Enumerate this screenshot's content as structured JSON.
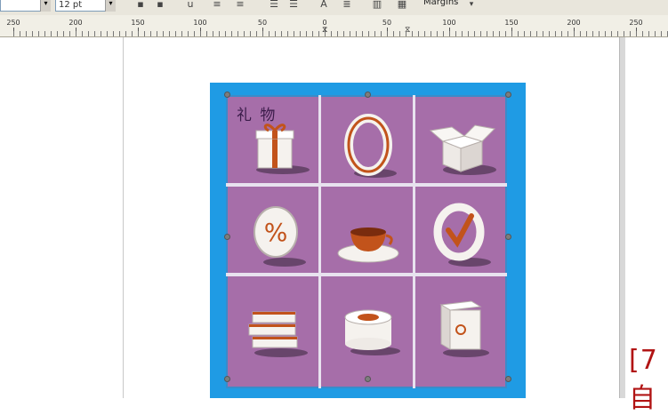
{
  "toolbar": {
    "font_size_value": "12 pt",
    "margins_label": "Margins"
  },
  "ruler": {
    "labels": [
      "250",
      "200",
      "150",
      "100",
      "50",
      "0",
      "50",
      "100",
      "150",
      "200",
      "250"
    ]
  },
  "image": {
    "caption": "礼 物",
    "frame_color": "#1f9be4",
    "tile_color": "#a66ea9",
    "icons": [
      "gift-box-icon",
      "ring-icon",
      "open-box-icon",
      "percent-icon",
      "coffee-cup-icon",
      "checkmark-icon",
      "books-icon",
      "cake-icon",
      "safe-icon"
    ]
  },
  "overlay": {
    "partial_text": "[7自"
  },
  "colors": {
    "accent_orange": "#c2531b",
    "icon_white": "#f5f2ee"
  }
}
